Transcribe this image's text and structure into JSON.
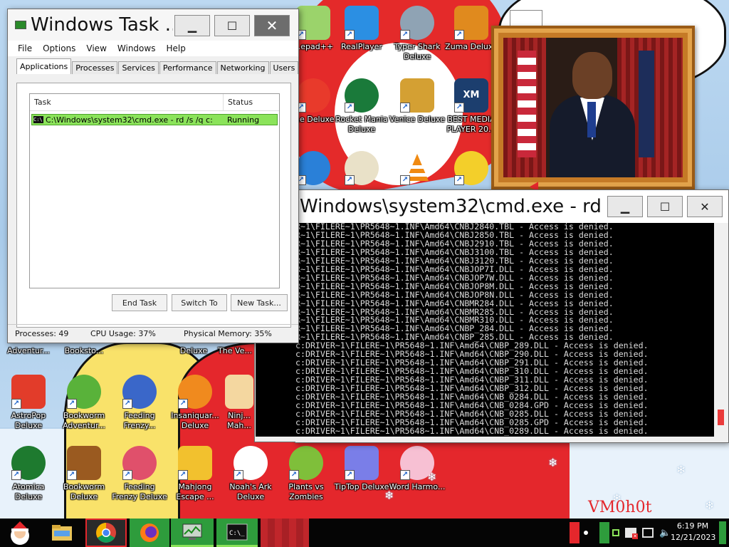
{
  "desktop": {
    "icons": [
      {
        "label": "...epad++"
      },
      {
        "label": "RealPlayer"
      },
      {
        "label": "Typer Shark Deluxe"
      },
      {
        "label": "Zuma Deluxe"
      },
      {
        "label": "...e Deluxe"
      },
      {
        "label": "Rocket Mania Deluxe"
      },
      {
        "label": "Venice Deluxe"
      },
      {
        "label": "BEST MEDIA PLAYER 20..."
      },
      {
        "label": "Adventur..."
      },
      {
        "label": "Booksto..."
      },
      {
        "label": "Deluxe"
      },
      {
        "label": "The Ve..."
      },
      {
        "label": "AstroPop Deluxe"
      },
      {
        "label": "Bookworm Adventur..."
      },
      {
        "label": "Feeding Frenzy..."
      },
      {
        "label": "Insaniquar... Deluxe"
      },
      {
        "label": "Ninj... Mah..."
      },
      {
        "label": "Atomica Deluxe"
      },
      {
        "label": "Bookworm Deluxe"
      },
      {
        "label": "Feeding Frenzy Deluxe"
      },
      {
        "label": "Mahjong Escape ..."
      },
      {
        "label": "Noah's Ark Deluxe"
      },
      {
        "label": "Plants vs Zombies"
      },
      {
        "label": "TipTop Deluxe"
      },
      {
        "label": "Word Harmo..."
      }
    ],
    "wallpaper_text": "VM0h0t"
  },
  "taskmgr": {
    "title": "Windows Task ...",
    "menu": [
      "File",
      "Options",
      "View",
      "Windows",
      "Help"
    ],
    "tabs": [
      "Applications",
      "Processes",
      "Services",
      "Performance",
      "Networking",
      "Users"
    ],
    "active_tab": "Applications",
    "columns": {
      "task": "Task",
      "status": "Status"
    },
    "rows": [
      {
        "task": "C:\\Windows\\system32\\cmd.exe - rd  /s /q c:",
        "status": "Running"
      }
    ],
    "buttons": {
      "end_task": "End Task",
      "switch_to": "Switch To",
      "new_task": "New Task..."
    },
    "status": {
      "processes": "Processes: 49",
      "cpu": "CPU Usage: 37%",
      "memory": "Physical Memory: 35%"
    }
  },
  "cmd": {
    "title": "Windows\\system32\\cmd.exe - rd  ...",
    "lines": [
      "R~1\\FILERE~1\\PR5648~1.INF\\Amd64\\CNBJ2840.TBL - Access is denied.",
      "R~1\\FILERE~1\\PR5648~1.INF\\Amd64\\CNBJ2850.TBL - Access is denied.",
      "R~1\\FILERE~1\\PR5648~1.INF\\Amd64\\CNBJ2910.TBL - Access is denied.",
      "R~1\\FILERE~1\\PR5648~1.INF\\Amd64\\CNBJ3100.TBL - Access is denied.",
      "R~1\\FILERE~1\\PR5648~1.INF\\Amd64\\CNBJ3120.TBL - Access is denied.",
      "R~1\\FILERE~1\\PR5648~1.INF\\Amd64\\CNBJOP7I.DLL - Access is denied.",
      "R~1\\FILERE~1\\PR5648~1.INF\\Amd64\\CNBJOP7W.DLL - Access is denied.",
      "R~1\\FILERE~1\\PR5648~1.INF\\Amd64\\CNBJOP8M.DLL - Access is denied.",
      "R~1\\FILERE~1\\PR5648~1.INF\\Amd64\\CNBJOP8N.DLL - Access is denied.",
      "R~1\\FILERE~1\\PR5648~1.INF\\Amd64\\CNBMR284.DLL - Access is denied.",
      "R~1\\FILERE~1\\PR5648~1.INF\\Amd64\\CNBMR285.DLL - Access is denied.",
      "R~1\\FILERE~1\\PR5648~1.INF\\Amd64\\CNBMR310.DLL - Access is denied.",
      "R~1\\FILERE~1\\PR5648~1.INF\\Amd64\\CNBP_284.DLL - Access is denied.",
      "R~1\\FILERE~1\\PR5648~1.INF\\Amd64\\CNBP_285.DLL - Access is denied.",
      "c:DRIVER~1\\FILERE~1\\PR5648~1.INF\\Amd64\\CNBP_289.DLL - Access is denied.",
      "c:DRIVER~1\\FILERE~1\\PR5648~1.INF\\Amd64\\CNBP_290.DLL - Access is denied.",
      "c:DRIVER~1\\FILERE~1\\PR5648~1.INF\\Amd64\\CNBP_291.DLL - Access is denied.",
      "c:DRIVER~1\\FILERE~1\\PR5648~1.INF\\Amd64\\CNBP_310.DLL - Access is denied.",
      "c:DRIVER~1\\FILERE~1\\PR5648~1.INF\\Amd64\\CNBP_311.DLL - Access is denied.",
      "c:DRIVER~1\\FILERE~1\\PR5648~1.INF\\Amd64\\CNBP_312.DLL - Access is denied.",
      "c:DRIVER~1\\FILERE~1\\PR5648~1.INF\\Amd64\\CNB_0284.DLL - Access is denied.",
      "c:DRIVER~1\\FILERE~1\\PR5648~1.INF\\Amd64\\CNB_0284.GPD - Access is denied.",
      "c:DRIVER~1\\FILERE~1\\PR5648~1.INF\\Amd64\\CNB_0285.DLL - Access is denied.",
      "c:DRIVER~1\\FILERE~1\\PR5648~1.INF\\Amd64\\CNB_0285.GPD - Access is denied.",
      "c:DRIVER~1\\FILERE~1\\PR5648~1.INF\\Amd64\\CNB_0289.DLL - Access is denied."
    ]
  },
  "taskbar": {
    "clock_time": "6:19 PM",
    "clock_date": "12/21/2023",
    "items": [
      "start-button",
      "file-explorer",
      "chrome",
      "firefox",
      "task-manager",
      "cmd"
    ]
  },
  "colors": {
    "accent_red": "#e4272c",
    "selected_row": "#8be35a",
    "console_bg": "#000000",
    "taskbar_bg": "#050505"
  }
}
